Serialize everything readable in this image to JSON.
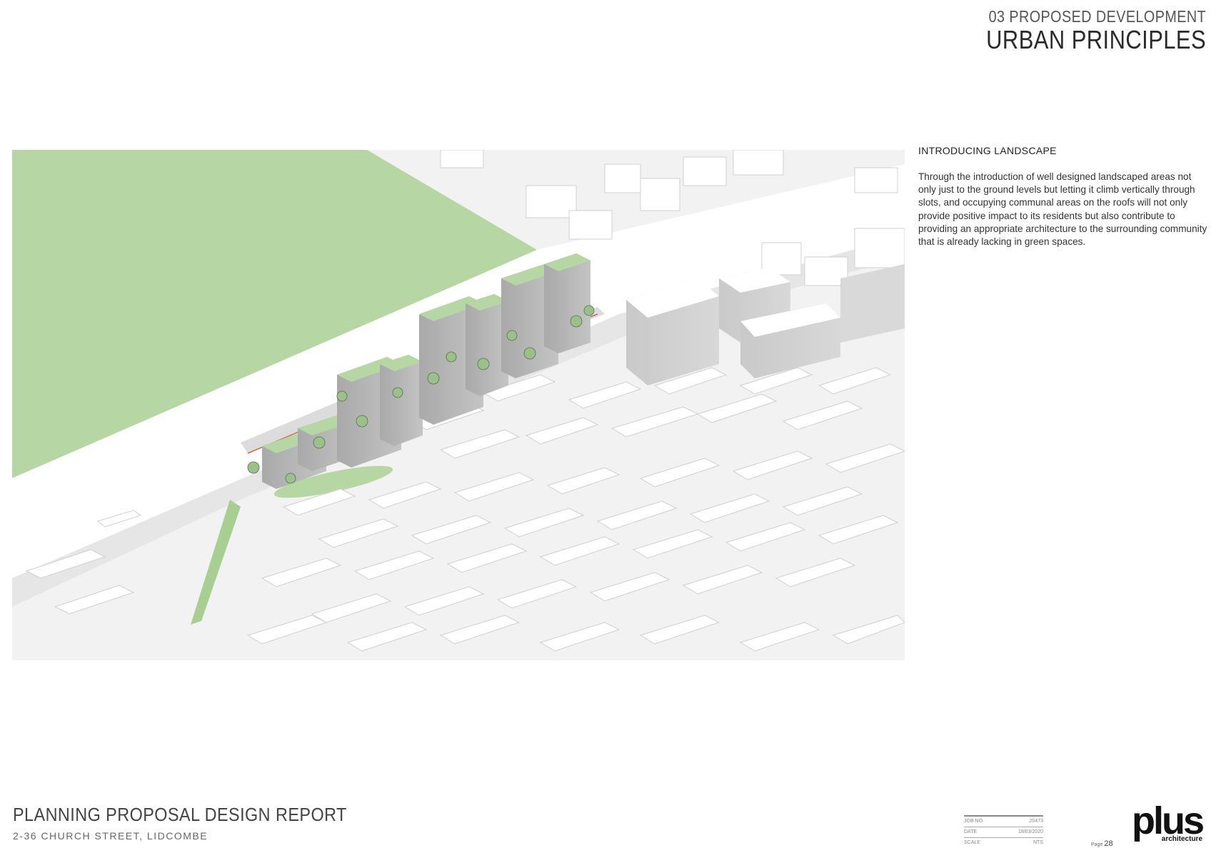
{
  "header": {
    "section": "03 PROPOSED DEVELOPMENT",
    "title": "URBAN PRINCIPLES"
  },
  "sidebar": {
    "heading": "INTRODUCING LANDSCAPE",
    "body": "Through the introduction of well designed landscaped areas not only just to the ground levels but letting it climb vertically through slots, and occupying communal areas on the roofs will not only provide positive impact to its residents but also contribute to providing an appropriate architecture to the surrounding community that is already lacking in green spaces."
  },
  "footer": {
    "report_title": "PLANNING PROPOSAL DESIGN REPORT",
    "address": "2-36 CHURCH STREET, LIDCOMBE"
  },
  "info_table": {
    "rows": [
      {
        "label": "JOB NO.",
        "value": "20473"
      },
      {
        "label": "DATE",
        "value": "18/03/2020"
      },
      {
        "label": "SCALE",
        "value": "NTS"
      }
    ]
  },
  "page": {
    "label": "Page",
    "number": "28"
  },
  "logo": {
    "word": "plus",
    "sub": "architecture"
  },
  "colors": {
    "park_green": "#b6d7a3",
    "building_white": "#ffffff",
    "accent_line": "#d2694b"
  }
}
